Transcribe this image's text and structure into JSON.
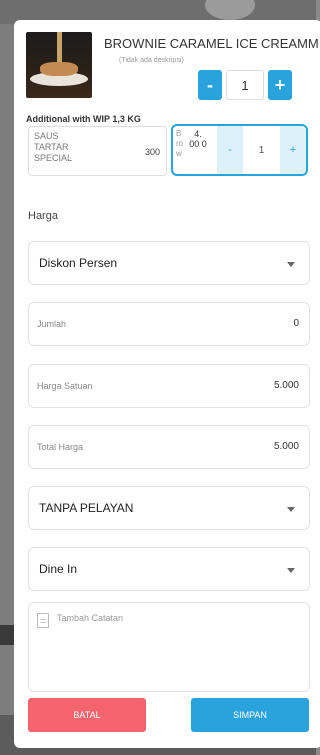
{
  "product": {
    "name": "BROWNIE CARAMEL ICE CREAMM",
    "description": "(Tidak ada deskripsi)",
    "quantity": "1",
    "minus_label": "-",
    "plus_label": "+"
  },
  "addon": {
    "section_title": "Additional with WIP 1,3 KG",
    "item_name": "SAUS TARTAR SPECIAL",
    "item_price": "300",
    "stock_label": "B ro w",
    "stock_value": "4. 00 0",
    "quantity": "1",
    "minus_label": "-",
    "plus_label": "+"
  },
  "harga": {
    "section_label": "Harga",
    "discount_select": "Diskon Persen",
    "jumlah": {
      "placeholder": "Jumlah",
      "value": "0"
    },
    "harga_satuan": {
      "placeholder": "Harga Satuan",
      "value": "5.000"
    },
    "total_harga": {
      "placeholder": "Total Harga",
      "value": "5.000"
    },
    "pelayan_select": "TANPA PELAYAN",
    "dine_select": "Dine In",
    "notes_placeholder": "Tambah Catatan"
  },
  "actions": {
    "cancel": "BATAL",
    "save": "SIMPAN"
  },
  "colors": {
    "primary": "#2aa3dc",
    "danger": "#f4646e"
  }
}
